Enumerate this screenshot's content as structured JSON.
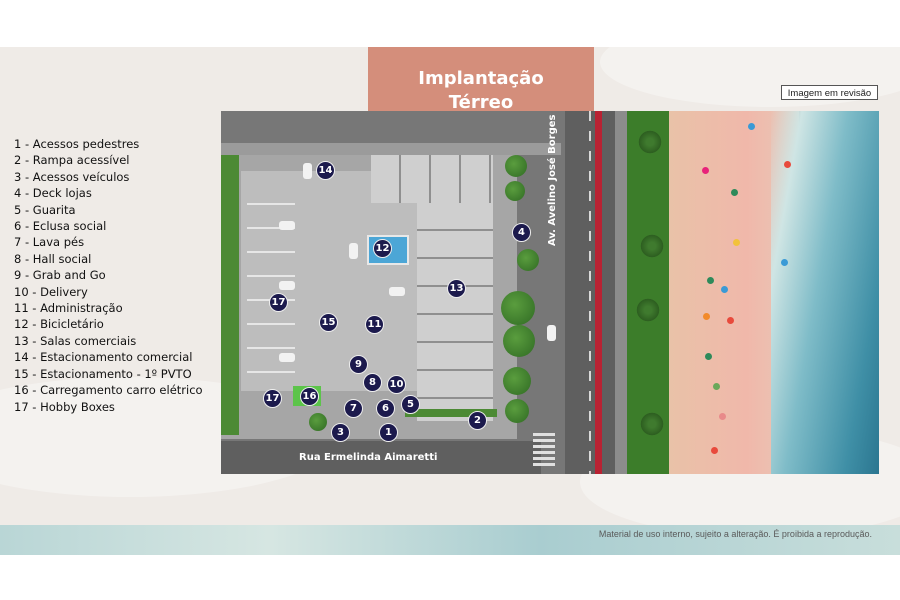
{
  "title": {
    "line1": "Implantação",
    "line2": "Térreo"
  },
  "review_button": "Imagem em revisão",
  "legend": [
    "1 - Acessos pedestres",
    "2 - Rampa acessível",
    "3 - Acessos veículos",
    "4 - Deck lojas",
    "5 - Guarita",
    "6 - Eclusa social",
    "7 - Lava pés",
    "8 - Hall social",
    "9 - Grab and Go",
    "10 - Delivery",
    "11 - Administração",
    "12 - Bicicletário",
    "13 - Salas comerciais",
    "14 - Estacionamento comercial",
    "15 - Estacionamento - 1º PVTO",
    "16 - Carregamento carro elétrico",
    "17 - Hobby Boxes"
  ],
  "map": {
    "street_vertical": "Av. Avelino José Borges",
    "street_horizontal": "Rua Ermelinda Aimaretti",
    "markers": [
      "14",
      "4",
      "12",
      "13",
      "17",
      "15",
      "11",
      "9",
      "8",
      "10",
      "17",
      "16",
      "7",
      "6",
      "5",
      "2",
      "3",
      "1"
    ]
  },
  "footnote": "Material de uso interno, sujeito a alteração. É proibida a reprodução.",
  "colors": {
    "title_bg": "#d48e7b",
    "marker": "#1c1a4d",
    "bike_lane": "#b92233"
  }
}
